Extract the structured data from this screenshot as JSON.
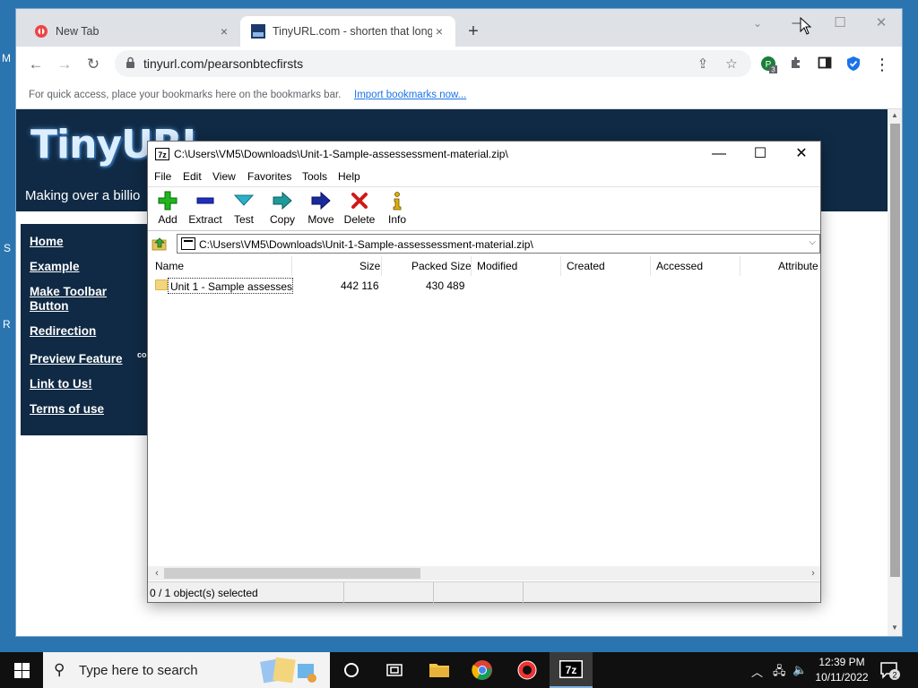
{
  "desktop": {
    "letters": [
      "M",
      "S",
      "R"
    ]
  },
  "browser": {
    "tabs": [
      {
        "title": "New Tab",
        "close": "×"
      },
      {
        "title": "TinyURL.com - shorten that long",
        "close": "×"
      }
    ],
    "new_tab": "+",
    "window_controls": [
      "⌄",
      "—",
      "☐",
      "✕"
    ],
    "nav": {
      "back": "←",
      "forward": "→",
      "reload": "↻"
    },
    "url": "tinyurl.com/pearsonbtecfirsts",
    "extension_badge": "3",
    "bookmarks_hint": "For quick access, place your bookmarks here on the bookmarks bar.",
    "bookmarks_link": "Import bookmarks now..."
  },
  "tinyurl": {
    "logo": "TinyURL",
    "tagline": "Making over a billio",
    "nav": [
      "Home",
      "Example",
      "Make Toolbar Button",
      "Redirection",
      "Preview Feature",
      "Link to Us!",
      "Terms of use"
    ],
    "preview_sup": "co"
  },
  "sevenzip": {
    "title": "C:\\Users\\VM5\\Downloads\\Unit-1-Sample-assessessment-material.zip\\",
    "icon_label": "7z",
    "menu": [
      "File",
      "Edit",
      "View",
      "Favorites",
      "Tools",
      "Help"
    ],
    "toolbar": [
      "Add",
      "Extract",
      "Test",
      "Copy",
      "Move",
      "Delete",
      "Info"
    ],
    "address": "C:\\Users\\VM5\\Downloads\\Unit-1-Sample-assessessment-material.zip\\",
    "columns": [
      "Name",
      "Size",
      "Packed Size",
      "Modified",
      "Created",
      "Accessed",
      "Attribute"
    ],
    "rows": [
      {
        "name": "Unit 1 - Sample assesses...",
        "size": "442 116",
        "packed": "430 489"
      }
    ],
    "status": "0 / 1 object(s) selected",
    "colors": {
      "add": "#1fb51f",
      "extract": "#1f2fbf",
      "test": "#2ab0c8",
      "copy": "#1f9a9a",
      "move": "#1a2a9a",
      "delete": "#d01818",
      "info": "#e0b000"
    }
  },
  "taskbar": {
    "search_placeholder": "Type here to search",
    "active_app": "7z",
    "time": "12:39 PM",
    "date": "10/11/2022",
    "notification_count": "2"
  }
}
